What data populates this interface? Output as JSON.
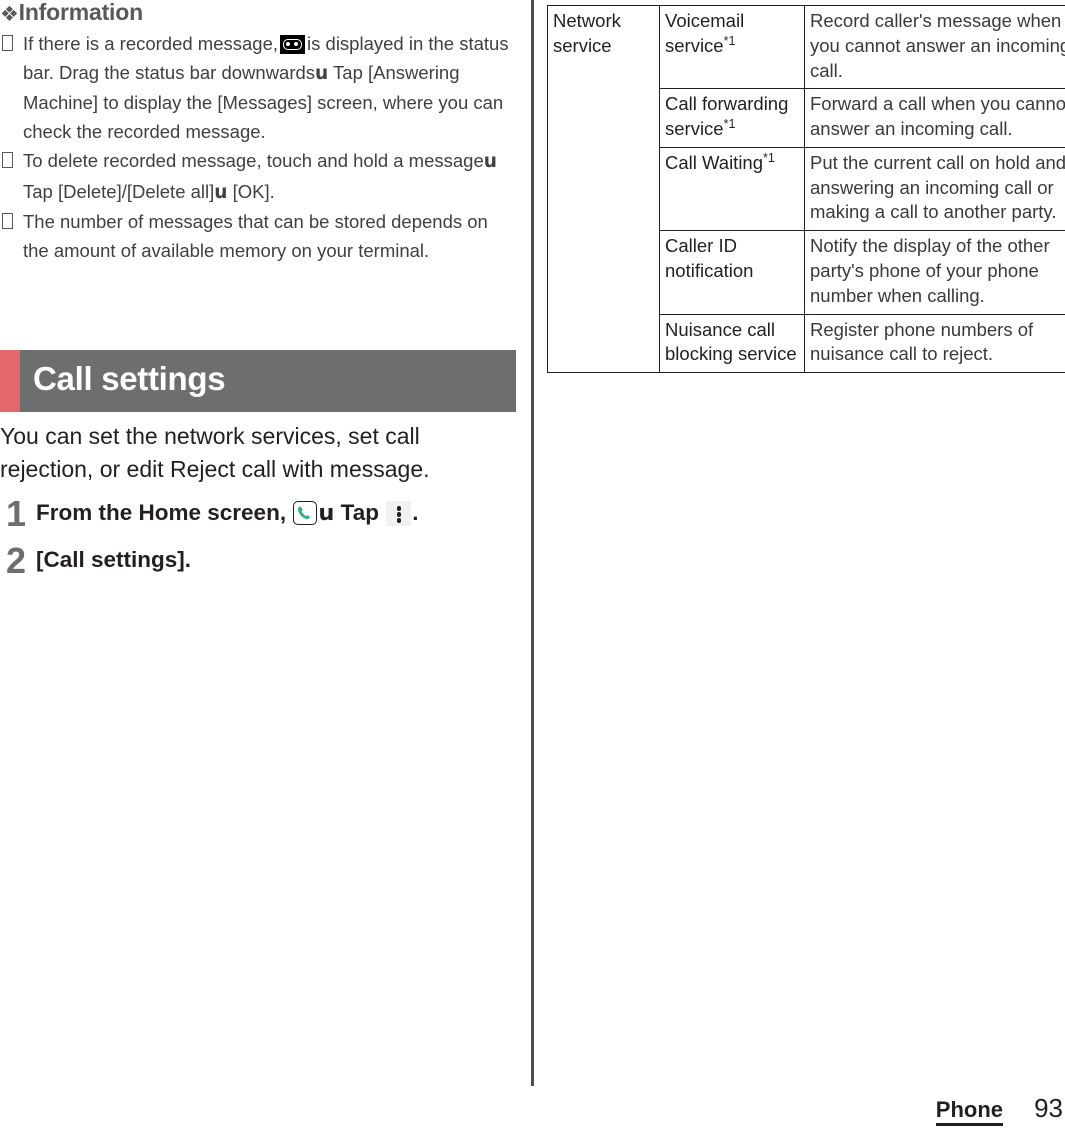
{
  "information": {
    "heading": "Information",
    "diamond_icon": "four-diamond-icon",
    "notes": [
      {
        "part1": "If there is a recorded message,",
        "icon": "voicemail-icon",
        "part2": "is displayed in the status bar. Drag the status bar downwards",
        "arrow": "u",
        "part3": "Tap [Answering Machine] to display the [Messages] screen, where you can check the recorded message."
      },
      {
        "part1": "To delete recorded message, touch and hold a message",
        "arrow": "u",
        "part2": "Tap [Delete]/[Delete all]",
        "arrow2": "u",
        "part3": "[OK]."
      },
      {
        "part1": "The number of messages that can be stored depends on the amount of available memory on your terminal."
      }
    ]
  },
  "section": {
    "title": "Call settings",
    "accent_color": "#e2686b",
    "bar_color": "#6d6e70",
    "intro": "You can set the network services, set call rejection, or edit Reject call with message."
  },
  "steps": [
    {
      "number": "1",
      "text_before_icon": "From the Home screen,",
      "phone_icon": "phone-app-icon",
      "arrow": "u",
      "text_after_icon": "Tap",
      "kebab_icon": "kebab-menu-icon",
      "text_end": "."
    },
    {
      "number": "2",
      "text": "[Call settings]."
    }
  ],
  "table": {
    "rows": [
      {
        "category": "Network service",
        "feature": "Voicemail service",
        "feature_sup": "*1",
        "description": "Record caller's message when you cannot answer an incoming call."
      },
      {
        "feature": "Call forwarding service",
        "feature_sup": "*1",
        "description": "Forward a call when you cannot answer an incoming call."
      },
      {
        "feature": "Call Waiting",
        "feature_sup": "*1",
        "description": "Put the current call on hold and answering an incoming call or making a call to another party."
      },
      {
        "feature": "Caller ID notification",
        "feature_sup": "",
        "description": "Notify the display of the other party's phone of your phone number when calling."
      },
      {
        "feature": "Nuisance call blocking service",
        "feature_sup": "",
        "description": "Register phone numbers of nuisance call to reject."
      }
    ]
  },
  "footer": {
    "chapter": "Phone",
    "page_number": "93"
  }
}
